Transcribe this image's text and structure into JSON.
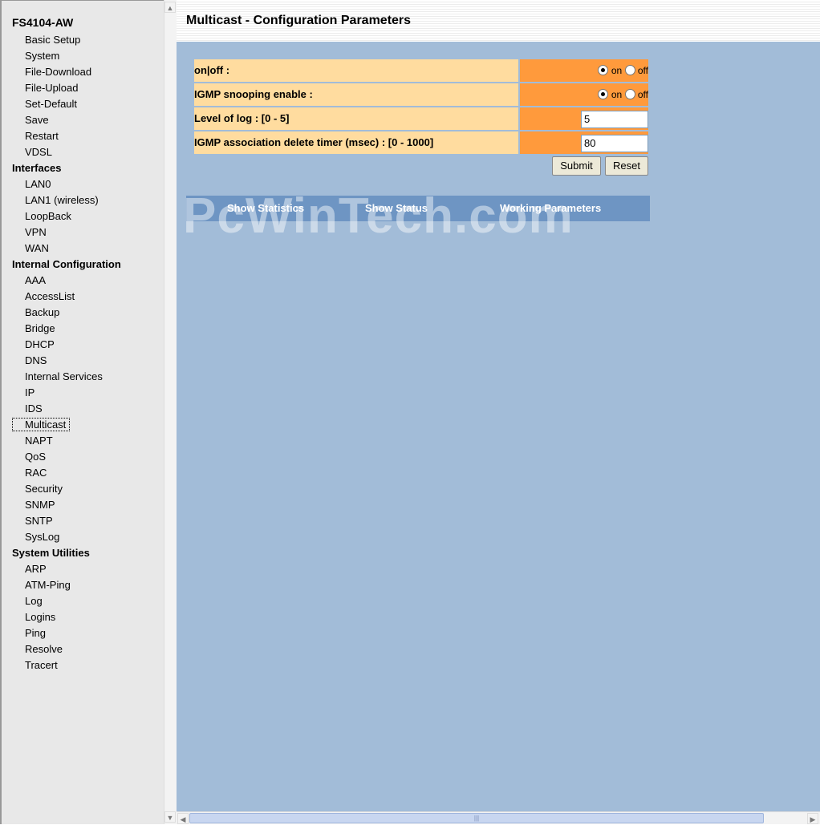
{
  "nav": {
    "title": "FS4104-AW",
    "groups": [
      {
        "label": "Basic Setup",
        "items": [
          "System",
          "File-Download",
          "File-Upload",
          "Set-Default",
          "Save",
          "Restart",
          "VDSL"
        ]
      },
      {
        "label": "Interfaces",
        "items": [
          "LAN0",
          "LAN1 (wireless)",
          "LoopBack",
          "VPN",
          "WAN"
        ]
      },
      {
        "label": "Internal Configuration",
        "items": [
          "AAA",
          "AccessList",
          "Backup",
          "Bridge",
          "DHCP",
          "DNS",
          "Internal Services",
          "IP",
          "IDS",
          "Multicast",
          "NAPT",
          "QoS",
          "RAC",
          "Security",
          "SNMP",
          "SNTP",
          "SysLog"
        ]
      },
      {
        "label": "System Utilities",
        "items": [
          "ARP",
          "ATM-Ping",
          "Log",
          "Logins",
          "Ping",
          "Resolve",
          "Tracert"
        ]
      }
    ],
    "active_item": "Multicast"
  },
  "header": {
    "title": "Multicast - Configuration Parameters"
  },
  "form": {
    "rows": [
      {
        "label": "on|off :",
        "type": "radio",
        "on_label": "on",
        "off_label": "off",
        "value": "on"
      },
      {
        "label": "IGMP snooping enable :",
        "type": "radio",
        "on_label": "on",
        "off_label": "off",
        "value": "on"
      },
      {
        "label": "Level of log : [0 - 5]",
        "type": "text",
        "value": "5"
      },
      {
        "label": "IGMP association delete timer (msec) : [0 - 1000]",
        "type": "text",
        "value": "80"
      }
    ],
    "submit_label": "Submit",
    "reset_label": "Reset"
  },
  "links": [
    "Show Statistics",
    "Show Status",
    "Working Parameters"
  ],
  "watermark": "PcWinTech.com",
  "colors": {
    "label_bg": "#ffdc9f",
    "value_bg": "#ff9a3c",
    "page_bg": "#a2bcd8",
    "linkbar_bg": "#6e95c3"
  }
}
